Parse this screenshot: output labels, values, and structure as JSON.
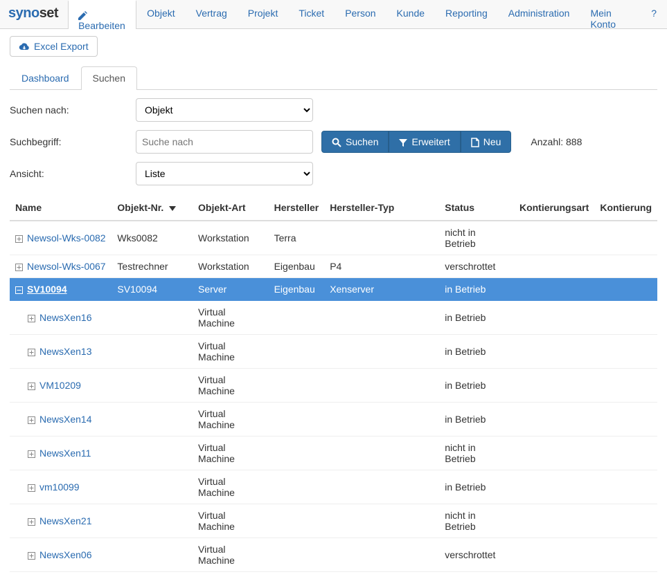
{
  "brand": {
    "part1": "syno",
    "part2": "set"
  },
  "nav": {
    "items": [
      {
        "label": "Bearbeiten",
        "active": true,
        "icon": "edit"
      },
      {
        "label": "Objekt"
      },
      {
        "label": "Vertrag"
      },
      {
        "label": "Projekt"
      },
      {
        "label": "Ticket"
      },
      {
        "label": "Person"
      },
      {
        "label": "Kunde"
      },
      {
        "label": "Reporting"
      },
      {
        "label": "Administration"
      },
      {
        "label": "Mein Konto"
      },
      {
        "label": "?"
      }
    ]
  },
  "toolbar": {
    "excel_export": "Excel Export"
  },
  "subtabs": {
    "items": [
      {
        "label": "Dashboard",
        "active": false
      },
      {
        "label": "Suchen",
        "active": true
      }
    ]
  },
  "form": {
    "suchen_nach_label": "Suchen nach:",
    "suchen_nach_value": "Objekt",
    "suchbegriff_label": "Suchbegriff:",
    "suchbegriff_placeholder": "Suche nach",
    "suchbegriff_value": "",
    "ansicht_label": "Ansicht:",
    "ansicht_value": "Liste",
    "btn_suchen": "Suchen",
    "btn_erweitert": "Erweitert",
    "btn_neu": "Neu",
    "count_label": "Anzahl: 888"
  },
  "table": {
    "headers": {
      "name": "Name",
      "objekt_nr": "Objekt-Nr.",
      "objekt_art": "Objekt-Art",
      "hersteller": "Hersteller",
      "hersteller_typ": "Hersteller-Typ",
      "status": "Status",
      "kontierungsart": "Kontierungsart",
      "kontierung": "Kontierung"
    },
    "rows": [
      {
        "indent": 0,
        "expander": "plus",
        "selected": false,
        "name": "Newsol-Wks-0082",
        "objekt_nr": "Wks0082",
        "objekt_art": "Workstation",
        "hersteller": "Terra",
        "hersteller_typ": "",
        "status": "nicht in Betrieb"
      },
      {
        "indent": 0,
        "expander": "plus",
        "selected": false,
        "name": "Newsol-Wks-0067",
        "objekt_nr": "Testrechner",
        "objekt_art": "Workstation",
        "hersteller": "Eigenbau",
        "hersteller_typ": "P4",
        "status": "verschrottet"
      },
      {
        "indent": 0,
        "expander": "minus",
        "selected": true,
        "name": "SV10094",
        "objekt_nr": "SV10094",
        "objekt_art": "Server",
        "hersteller": "Eigenbau",
        "hersteller_typ": "Xenserver",
        "status": "in Betrieb"
      },
      {
        "indent": 1,
        "expander": "plus",
        "selected": false,
        "name": "NewsXen16",
        "objekt_nr": "",
        "objekt_art": "Virtual Machine",
        "hersteller": "",
        "hersteller_typ": "",
        "status": "in Betrieb"
      },
      {
        "indent": 1,
        "expander": "plus",
        "selected": false,
        "name": "NewsXen13",
        "objekt_nr": "",
        "objekt_art": "Virtual Machine",
        "hersteller": "",
        "hersteller_typ": "",
        "status": "in Betrieb"
      },
      {
        "indent": 1,
        "expander": "plus",
        "selected": false,
        "name": "VM10209",
        "objekt_nr": "",
        "objekt_art": "Virtual Machine",
        "hersteller": "",
        "hersteller_typ": "",
        "status": "in Betrieb"
      },
      {
        "indent": 1,
        "expander": "plus",
        "selected": false,
        "name": "NewsXen14",
        "objekt_nr": "",
        "objekt_art": "Virtual Machine",
        "hersteller": "",
        "hersteller_typ": "",
        "status": "in Betrieb"
      },
      {
        "indent": 1,
        "expander": "plus",
        "selected": false,
        "name": "NewsXen11",
        "objekt_nr": "",
        "objekt_art": "Virtual Machine",
        "hersteller": "",
        "hersteller_typ": "",
        "status": "nicht in Betrieb"
      },
      {
        "indent": 1,
        "expander": "plus",
        "selected": false,
        "name": "vm10099",
        "objekt_nr": "",
        "objekt_art": "Virtual Machine",
        "hersteller": "",
        "hersteller_typ": "",
        "status": "in Betrieb"
      },
      {
        "indent": 1,
        "expander": "plus",
        "selected": false,
        "name": "NewsXen21",
        "objekt_nr": "",
        "objekt_art": "Virtual Machine",
        "hersteller": "",
        "hersteller_typ": "",
        "status": "nicht in Betrieb"
      },
      {
        "indent": 1,
        "expander": "plus",
        "selected": false,
        "name": "NewsXen06",
        "objekt_nr": "",
        "objekt_art": "Virtual Machine",
        "hersteller": "",
        "hersteller_typ": "",
        "status": "verschrottet"
      }
    ]
  }
}
